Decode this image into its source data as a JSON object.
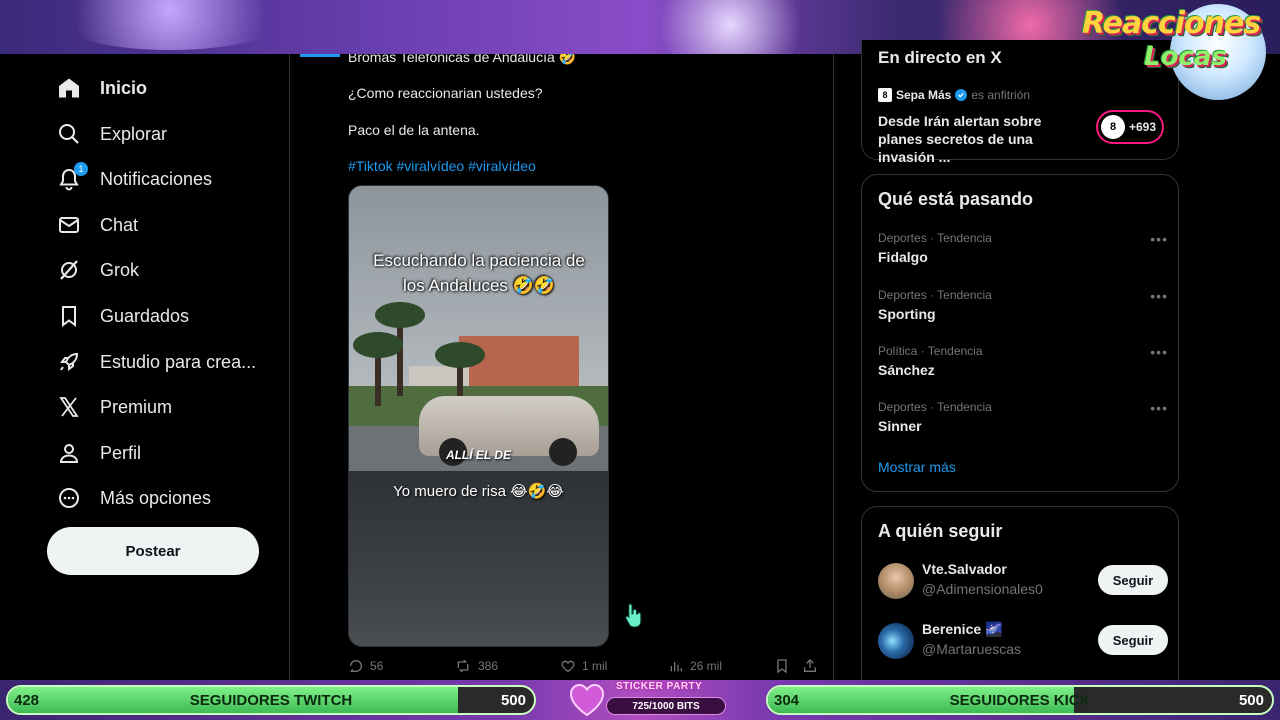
{
  "overlay": {
    "logo_line1": "Reacciones",
    "logo_line2": "Locas"
  },
  "nav": {
    "items": [
      {
        "label": "Inicio",
        "icon": "home-icon"
      },
      {
        "label": "Explorar",
        "icon": "search-icon"
      },
      {
        "label": "Notificaciones",
        "icon": "bell-icon",
        "badge": "1"
      },
      {
        "label": "Chat",
        "icon": "mail-icon"
      },
      {
        "label": "Grok",
        "icon": "grok-icon"
      },
      {
        "label": "Guardados",
        "icon": "bookmark-icon"
      },
      {
        "label": "Estudio para crea...",
        "icon": "rocket-icon"
      },
      {
        "label": "Premium",
        "icon": "x-logo-icon"
      },
      {
        "label": "Perfil",
        "icon": "person-icon"
      },
      {
        "label": "Más opciones",
        "icon": "more-circle-icon"
      }
    ],
    "post_label": "Postear"
  },
  "tweet": {
    "line_top": "Bromas Telefónicas de Andalucía 🤣",
    "line1": "¿Como reaccionarian ustedes?",
    "line2": "Paco el de la antena.",
    "hashtags": "#Tiktok #viralvídeo #viralvídeo",
    "video": {
      "caption_top": "Escuchando la paciencia de los Andaluces 🤣🤣",
      "caption_mid": "ALLÍ EL DE",
      "caption_bottom": "Yo muero de risa 😂🤣😂"
    },
    "actions": {
      "replies": "56",
      "reposts": "386",
      "likes": "1 mil",
      "views": "26 mil"
    }
  },
  "live": {
    "title": "En directo en X",
    "host_name": "Sepa Más",
    "host_role": "es anfitrión",
    "description": "Desde Irán alertan sobre planes secretos de una invasión ...",
    "listeners": "+693",
    "host_logo": "8"
  },
  "trends": {
    "title": "Qué está pasando",
    "items": [
      {
        "meta": "Deportes · Tendencia",
        "name": "Fidalgo"
      },
      {
        "meta": "Deportes · Tendencia",
        "name": "Sporting"
      },
      {
        "meta": "Política · Tendencia",
        "name": "Sánchez"
      },
      {
        "meta": "Deportes · Tendencia",
        "name": "Sinner"
      }
    ],
    "show_more": "Mostrar más"
  },
  "who_to_follow": {
    "title": "A quién seguir",
    "items": [
      {
        "name": "Vte.Salvador",
        "handle": "@Adimensionales0",
        "button": "Seguir"
      },
      {
        "name": "Berenice 🌌",
        "handle": "@Martaruescas",
        "button": "Seguir"
      }
    ]
  },
  "stream_bar": {
    "twitch": {
      "current": "428",
      "label": "SEGUIDORES TWITCH",
      "max": "500",
      "progress": 0.856
    },
    "kick": {
      "current": "304",
      "label": "SEGUIDORES KICK",
      "max": "500",
      "progress": 0.608
    },
    "sticker": {
      "title": "STICKER PARTY",
      "progress_text": "725/1000 BITS"
    }
  },
  "colors": {
    "accent": "#1d9bf0",
    "live_ring": "#f91880",
    "goal_green": "#3dbb52"
  }
}
